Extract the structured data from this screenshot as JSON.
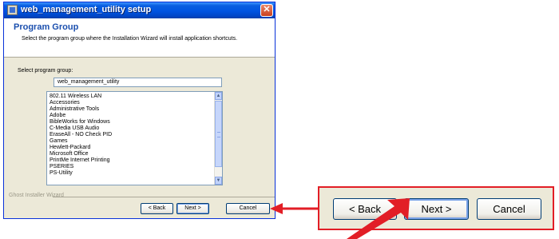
{
  "window": {
    "title": "web_management_utility setup",
    "close_glyph": "✕"
  },
  "header": {
    "title": "Program Group",
    "subtitle": "Select the program group where the Installation Wizard will install application shortcuts."
  },
  "form": {
    "select_label": "Select program group:",
    "group_value": "web_management_utility",
    "groups": [
      "802.11 Wireless LAN",
      "Accessories",
      "Administrative Tools",
      "Adobe",
      "BibleWorks for Windows",
      "C-Media USB Audio",
      "EraseAll - NO Check PID",
      "Games",
      "Hewlett-Packard",
      "Microsoft Office",
      "PrintMe Internet Printing",
      "PSERIES",
      "PS-Utility"
    ]
  },
  "footer": {
    "brand": "Ghost Installer Wizard",
    "back_label": "< Back",
    "next_label": "Next >",
    "cancel_label": "Cancel"
  },
  "zoom": {
    "back_label": "< Back",
    "next_label": "Next >",
    "cancel_label": "Cancel"
  },
  "annotation_color": "#e21e26"
}
